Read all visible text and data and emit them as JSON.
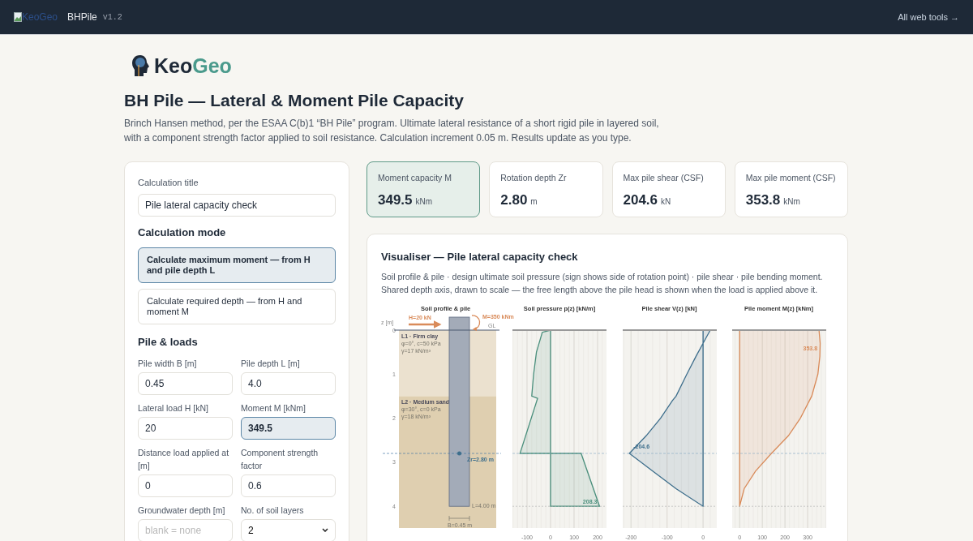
{
  "header": {
    "logo_alt": "KeoGeo",
    "app_name": "BHPile",
    "version": "v1.2",
    "link": "All web tools →"
  },
  "logo": {
    "primary": "Keo",
    "accent": "Geo"
  },
  "title": "BH Pile — Lateral & Moment Pile Capacity",
  "description": "Brinch Hansen method, per the ESAA C(b)1 “BH Pile” program. Ultimate lateral resistance of a short rigid pile in layered soil, with a component strength factor applied to soil resistance. Calculation increment 0.05 m. Results update as you type.",
  "form": {
    "title_field": {
      "label": "Calculation title",
      "value": "Pile lateral capacity check"
    },
    "mode_heading": "Calculation mode",
    "modes": [
      {
        "label": "Calculate maximum moment — from H and pile depth L",
        "selected": true
      },
      {
        "label": "Calculate required depth — from H and moment M",
        "selected": false
      }
    ],
    "loads_heading": "Pile & loads",
    "fields": [
      {
        "label": "Pile width B [m]",
        "kind": "input",
        "value": "0.45"
      },
      {
        "label": "Pile depth L [m]",
        "kind": "input",
        "value": "4.0"
      },
      {
        "label": "Lateral load H [kN]",
        "kind": "input",
        "value": "20"
      },
      {
        "label": "Moment M [kNm]",
        "kind": "result",
        "value": "349.5"
      },
      {
        "label": "Distance load applied at [m]",
        "kind": "input",
        "value": "0"
      },
      {
        "label": "Component strength factor",
        "kind": "input",
        "value": "0.6"
      },
      {
        "label": "Groundwater depth [m]",
        "kind": "input",
        "placeholder": "blank = none"
      },
      {
        "label": "No. of soil layers",
        "kind": "select",
        "value": "2"
      }
    ]
  },
  "results": [
    {
      "label": "Moment capacity M",
      "value": "349.5",
      "unit": "kNm",
      "highlighted": true
    },
    {
      "label": "Rotation depth Zr",
      "value": "2.80",
      "unit": "m",
      "highlighted": false
    },
    {
      "label": "Max pile shear (CSF)",
      "value": "204.6",
      "unit": "kN",
      "highlighted": false
    },
    {
      "label": "Max pile moment (CSF)",
      "value": "353.8",
      "unit": "kNm",
      "highlighted": false
    }
  ],
  "visualiser": {
    "title": "Visualiser — Pile lateral capacity check",
    "description": "Soil profile & pile · design ultimate soil pressure (sign shows side of rotation point) · pile shear · pile bending moment. Shared depth axis, drawn to scale — the free length above the pile head is shown when the load is applied above it.",
    "profile": {
      "title": "Soil profile & pile",
      "axis_label": "z [m]",
      "depth_ticks": [
        "0",
        "1",
        "2",
        "3",
        "4"
      ],
      "load_label": "H=20 kN",
      "moment_label": "M=350 kNm",
      "ground_label": "GL",
      "rotation_label": "Zr=2.80 m",
      "length_label": "L=4.00 m",
      "width_label": "B=0.45 m",
      "layers": [
        {
          "name": "L1 · Firm clay",
          "strength": "φ=0°, c=50 kPa",
          "unit_weight": "γ=17 kN/m³",
          "color": "#ebe1cf"
        },
        {
          "name": "L2 · Medium sand",
          "strength": "φ=30°, c=0 kPa",
          "unit_weight": "γ=18 kN/m³",
          "color": "#dfcfb0"
        }
      ]
    },
    "diagrams": [
      {
        "kind": "pressure",
        "title": "Soil pressure p(z) [kN/m]",
        "tick_labels": [
          "-100",
          "0",
          "100",
          "200"
        ],
        "value_label": "208.3",
        "color": "#4a8f7c"
      },
      {
        "kind": "shear",
        "title": "Pile shear V(z) [kN]",
        "tick_labels": [
          "-200",
          "-100",
          "0"
        ],
        "value_label": "-204.6",
        "color": "#3d6e8c"
      },
      {
        "kind": "moment",
        "title": "Pile moment M(z) [kNm]",
        "tick_labels": [
          "0",
          "100",
          "200",
          "300"
        ],
        "value_label": "353.8",
        "color": "#d98b5a"
      }
    ]
  }
}
